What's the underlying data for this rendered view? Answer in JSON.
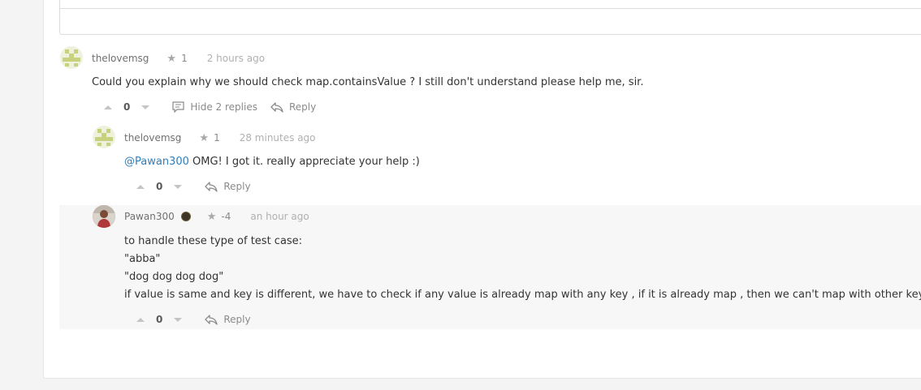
{
  "comments": [
    {
      "username": "thelovemsg",
      "reputation": "1",
      "time": "2 hours ago",
      "body": "Could you explain why we should check map.containsValue ? I still don't understand please help me, sir.",
      "votes": "0",
      "hide_replies_label": "Hide 2 replies",
      "reply_label": "Reply"
    },
    {
      "username": "thelovemsg",
      "reputation": "1",
      "time": "28 minutes ago",
      "mention": "@Pawan300",
      "body": " OMG! I got it. really appreciate your help :)",
      "votes": "0",
      "reply_label": "Reply"
    },
    {
      "username": "Pawan300",
      "reputation": "-4",
      "time": "an hour ago",
      "body_lines": [
        "to handle these type of test case:",
        "\"abba\"",
        "\"dog dog dog dog\"",
        "if value is same and key is different, we have to check if any value is already map with any key , if it is already map , then we can't map with other key"
      ],
      "votes": "0",
      "reply_label": "Reply"
    }
  ],
  "colors": {
    "mention": "#2f7fbd",
    "highlight_bg": "#f7f7f8"
  },
  "icons": [
    "star-icon",
    "upvote-icon",
    "downvote-icon",
    "comment-icon",
    "reply-icon",
    "badge-icon"
  ]
}
